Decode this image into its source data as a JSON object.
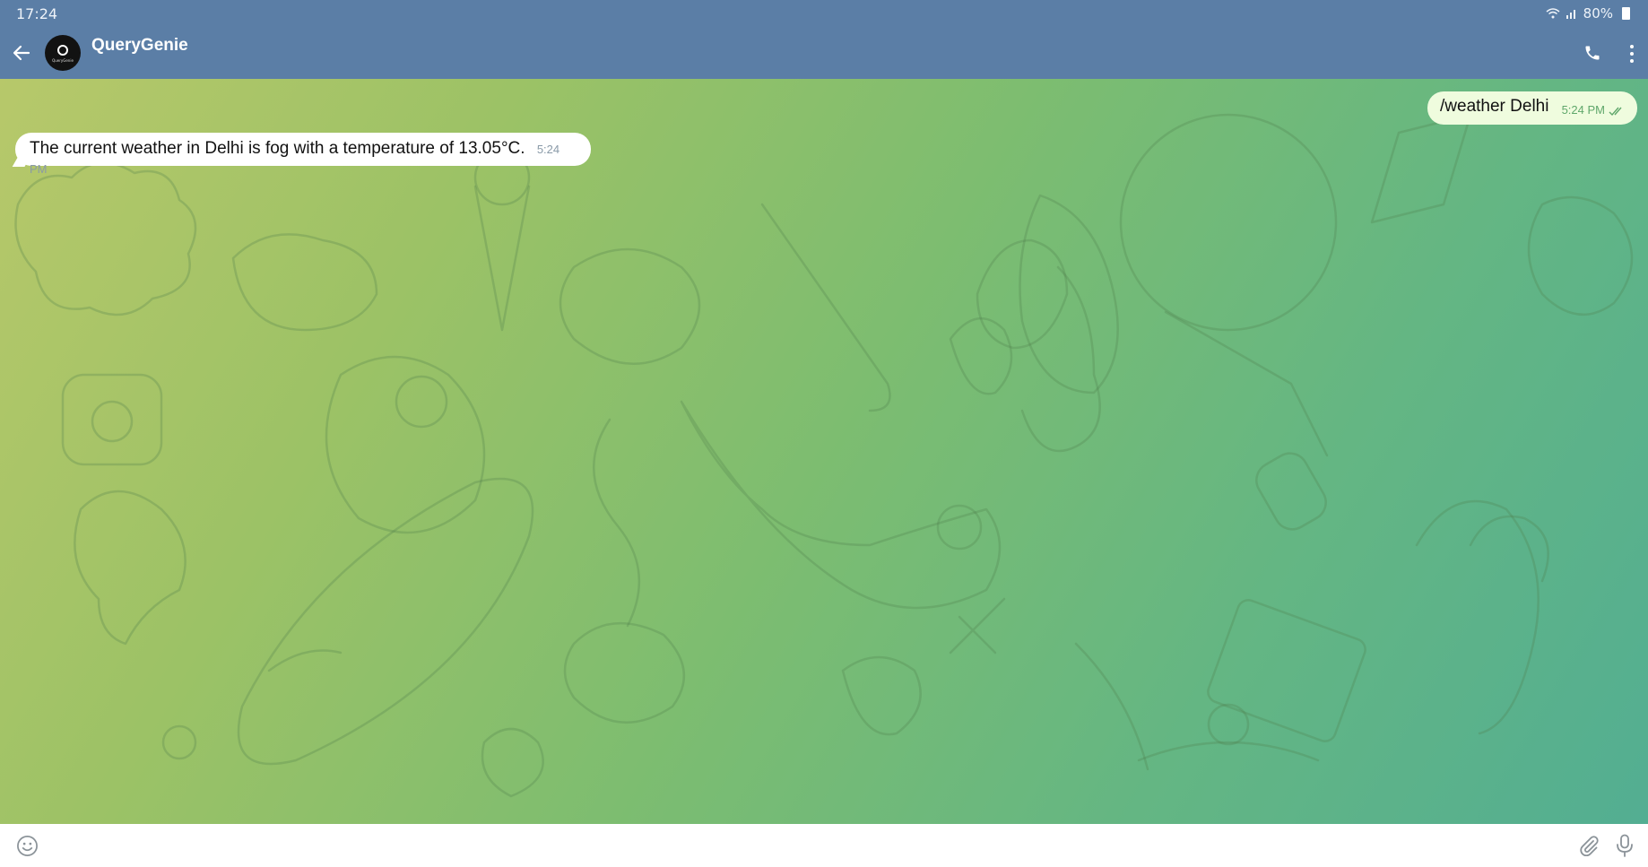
{
  "status": {
    "time": "17:24",
    "battery": "80%"
  },
  "header": {
    "title": "QueryGenie",
    "avatar_text": "QueryGenie"
  },
  "messages": [
    {
      "direction": "outgoing",
      "text": "/weather Delhi",
      "time": "5:24 PM",
      "status": "read"
    },
    {
      "direction": "incoming",
      "text": "The current weather in Delhi is fog with a temperature of 13.05°C.",
      "time": "5:24 PM"
    }
  ],
  "composer": {
    "value": "",
    "placeholder": ""
  },
  "icons": {
    "back": "arrow-left-icon",
    "call": "phone-icon",
    "more": "more-vertical-icon",
    "emoji": "smiley-icon",
    "attach": "paperclip-icon",
    "mic": "microphone-icon",
    "wifi": "wifi-icon",
    "signal": "signal-icon",
    "battery": "battery-icon"
  },
  "colors": {
    "header": "#5b7ea6",
    "outgoing_bubble": "#effcde",
    "incoming_bubble": "#ffffff"
  }
}
